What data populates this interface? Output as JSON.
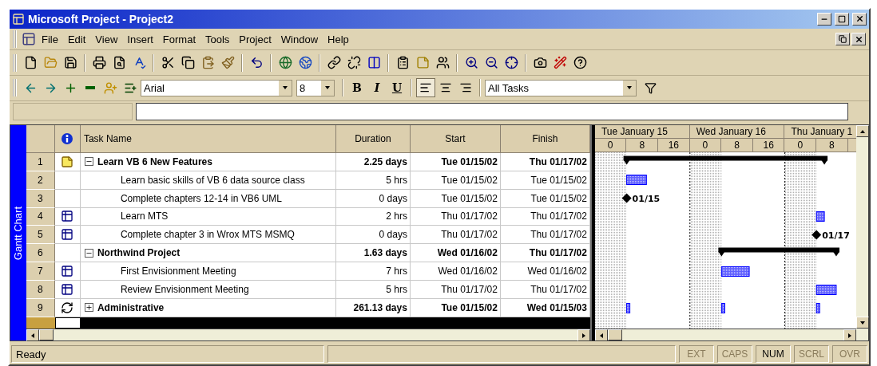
{
  "window": {
    "title": "Microsoft Project - Project2"
  },
  "menu": [
    {
      "label": "File"
    },
    {
      "label": "Edit"
    },
    {
      "label": "View"
    },
    {
      "label": "Insert"
    },
    {
      "label": "Format"
    },
    {
      "label": "Tools"
    },
    {
      "label": "Project"
    },
    {
      "label": "Window"
    },
    {
      "label": "Help"
    }
  ],
  "formatting": {
    "font": "Arial",
    "size": "8",
    "bold": "B",
    "italic": "I",
    "underline": "U",
    "alignment": [
      {
        "kind": "left",
        "selected": true
      },
      {
        "kind": "center",
        "selected": false
      },
      {
        "kind": "right",
        "selected": false
      }
    ],
    "filter": "All Tasks"
  },
  "view_bar": {
    "label": "Gantt Chart"
  },
  "table": {
    "columns": [
      "Task Name",
      "Duration",
      "Start",
      "Finish"
    ],
    "rows": [
      {
        "number": "1",
        "kind": "note",
        "name": "Learn VB 6 New Features",
        "duration": "2.25 days",
        "start": "Tue 01/15/02",
        "finish": "Thu 01/17/02",
        "expanded": true,
        "bar": {
          "kind": "summary"
        },
        "children": [
          {
            "number": "2",
            "name": "Learn basic skills of VB 6 data source class",
            "duration": "5 hrs",
            "start": "Tue 01/15/02",
            "finish": "Tue 01/15/02",
            "bar": {
              "kind": "task"
            }
          },
          {
            "number": "3",
            "name": "Complete chapters 12-14 in VB6 UML",
            "duration": "0 days",
            "start": "Tue 01/15/02",
            "finish": "Tue 01/15/02",
            "bar": {
              "kind": "milestone",
              "label": "01/15"
            }
          },
          {
            "number": "4",
            "kind": "calendar",
            "name": "Learn MTS",
            "duration": "2 hrs",
            "start": "Thu 01/17/02",
            "finish": "Thu 01/17/02",
            "bar": {
              "kind": "task"
            }
          },
          {
            "number": "5",
            "kind": "calendar",
            "name": "Complete chapter 3 in Wrox MTS MSMQ",
            "duration": "0 days",
            "start": "Thu 01/17/02",
            "finish": "Thu 01/17/02",
            "bar": {
              "kind": "milestone",
              "label": "01/17"
            }
          }
        ]
      },
      {
        "number": "6",
        "name": "Northwind Project",
        "duration": "1.63 days",
        "start": "Wed 01/16/02",
        "finish": "Thu 01/17/02",
        "expanded": true,
        "bar": {
          "kind": "summary"
        },
        "children": [
          {
            "number": "7",
            "kind": "calendar",
            "name": "First Envisionment Meeting",
            "duration": "7 hrs",
            "start": "Wed 01/16/02",
            "finish": "Wed 01/16/02",
            "bar": {
              "kind": "task"
            }
          },
          {
            "number": "8",
            "kind": "calendar",
            "name": "Review Envisionment Meeting",
            "duration": "5 hrs",
            "start": "Thu 01/17/02",
            "finish": "Thu 01/17/02",
            "bar": {
              "kind": "task"
            }
          }
        ]
      },
      {
        "number": "9",
        "kind": "recurring",
        "name": "Administrative",
        "duration": "261.13 days",
        "start": "Tue 01/15/02",
        "finish": "Wed 01/15/03",
        "expanded": false,
        "bar": {
          "kind": "recurring"
        }
      }
    ]
  },
  "timescale": {
    "days": [
      "Tue January 15",
      "Wed January 16",
      "Thu January 1"
    ],
    "ticks": [
      "0",
      "8",
      "16",
      "0",
      "8",
      "16",
      "0",
      "8"
    ]
  },
  "status_bar": {
    "message": "Ready",
    "indicators": [
      {
        "label": "EXT",
        "on": false
      },
      {
        "label": "CAPS",
        "on": false
      },
      {
        "label": "NUM",
        "on": true
      },
      {
        "label": "SCRL",
        "on": false
      },
      {
        "label": "OVR",
        "on": false
      }
    ]
  }
}
